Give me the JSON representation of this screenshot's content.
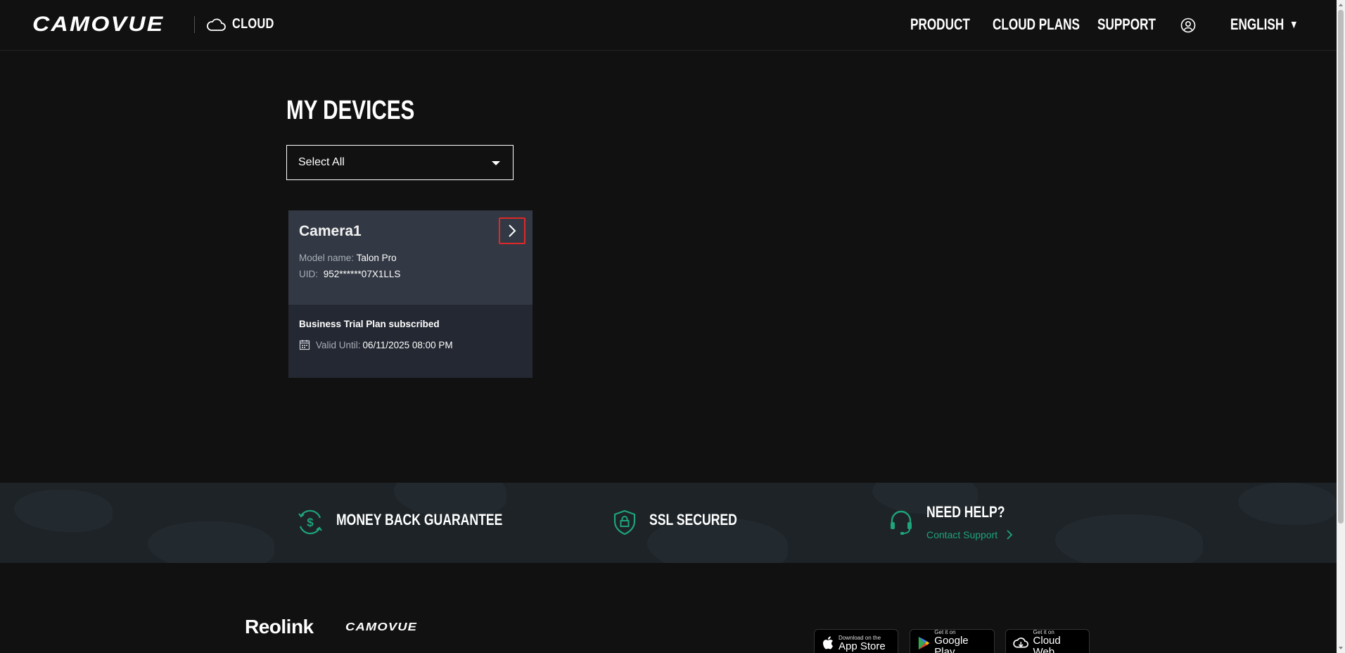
{
  "header": {
    "brand": "CAMOVUE",
    "section": "CLOUD",
    "nav": [
      "PRODUCT",
      "CLOUD PLANS",
      "SUPPORT"
    ],
    "language": "ENGLISH"
  },
  "main": {
    "title": "MY DEVICES",
    "filter": {
      "selected": "Select All"
    },
    "devices": [
      {
        "name": "Camera1",
        "model_label": "Model name:",
        "model": "Talon Pro",
        "uid_label": "UID:",
        "uid": "952******07X1LLS",
        "plan": "Business Trial Plan subscribed",
        "valid_label": "Valid Until:",
        "valid_until": "06/11/2025 08:00 PM"
      }
    ]
  },
  "banner": {
    "money_back": "MONEY BACK GUARANTEE",
    "ssl": "SSL SECURED",
    "help_title": "NEED HELP?",
    "contact": "Contact Support"
  },
  "footer": {
    "logo_reolink": "Reolink",
    "logo_camovue": "CAMOVUE",
    "badges": [
      {
        "small": "Download on the",
        "big": "App Store"
      },
      {
        "small": "Get it on",
        "big": "Google Play"
      },
      {
        "small": "Get it on",
        "big": "Cloud Web"
      }
    ]
  },
  "colors": {
    "accent_green": "#1fa37a",
    "highlight_red": "#e02828",
    "card_top": "#333944",
    "card_bottom": "#242832"
  }
}
